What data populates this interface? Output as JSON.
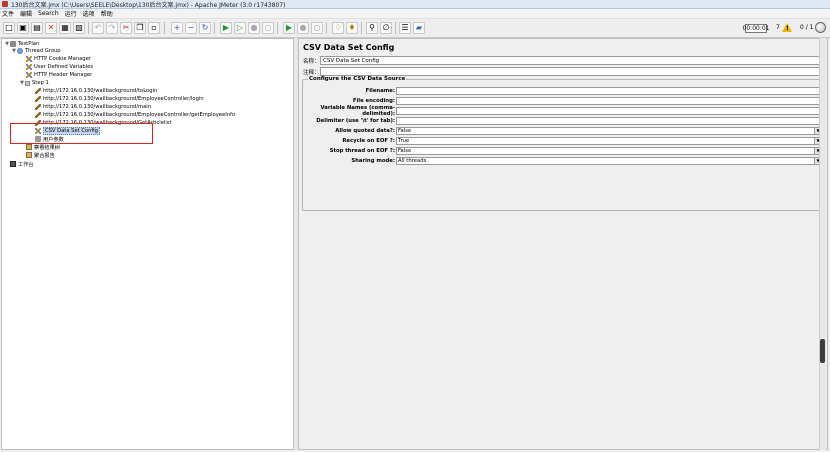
{
  "window": {
    "title": "130后台文案.jmx (C:\\Users\\SEELE\\Desktop\\130后台文案.jmx) - Apache JMeter (3.0 r1743807)"
  },
  "menu": [
    "文件",
    "编辑",
    "Search",
    "运行",
    "选项",
    "帮助"
  ],
  "toolbar": {
    "buttons": [
      "new-icon",
      "templates-icon",
      "open-icon",
      "close-icon",
      "save-icon",
      "save-as-icon",
      "undo-icon",
      "redo-icon",
      "cut-icon",
      "copy-icon",
      "paste-icon",
      "expand-icon",
      "collapse-icon",
      "toggle-icon",
      "start-icon",
      "start-no-pause-icon",
      "stop-icon",
      "shutdown-icon",
      "remote-start-icon",
      "remote-stop-icon",
      "remote-shutdown-icon",
      "clear-icon",
      "clear-all-icon",
      "search-icon",
      "reset-search-icon",
      "function-helper-icon",
      "help-icon"
    ],
    "elapsed_time": "00:00:01",
    "warning_count": "7",
    "active_threads": "0 / 1"
  },
  "tree": {
    "nodes": [
      {
        "label": "TestPlan",
        "icon": "testplan-icon",
        "indent": 0,
        "twisty": "▼"
      },
      {
        "label": "Thread Group",
        "icon": "thread-group-icon",
        "indent": 1,
        "twisty": "▼"
      },
      {
        "label": "HTTP Cookie Manager",
        "icon": "config-wrench-icon",
        "indent": 2,
        "twisty": ""
      },
      {
        "label": "User Defined Variables",
        "icon": "config-wrench-icon",
        "indent": 2,
        "twisty": ""
      },
      {
        "label": "HTTP Header Manager",
        "icon": "config-wrench-icon",
        "indent": 2,
        "twisty": ""
      },
      {
        "label": "Step 1",
        "icon": "transaction-controller-icon",
        "indent": 2,
        "twisty": "▼"
      },
      {
        "label": "http://172.16.0.130/wallbackground/toLogin",
        "icon": "sampler-pencil-icon",
        "indent": 3,
        "twisty": ""
      },
      {
        "label": "http://172.16.0.130/wallbackground/EmployeeController/login",
        "icon": "sampler-pencil-icon",
        "indent": 3,
        "twisty": ""
      },
      {
        "label": "http://172.16.0.130/wallbackground/main",
        "icon": "sampler-pencil-icon",
        "indent": 3,
        "twisty": ""
      },
      {
        "label": "http://172.16.0.130/wallbackground/EmployeeController/getEmployeeInfo",
        "icon": "sampler-pencil-icon",
        "indent": 3,
        "twisty": ""
      },
      {
        "label": "http://172.16.0.130/wallbackground/GetArticlelist",
        "icon": "sampler-pencil-icon",
        "indent": 3,
        "twisty": ""
      },
      {
        "label": "CSV Data Set Config",
        "icon": "config-wrench-icon",
        "indent": 3,
        "twisty": "",
        "selected": true
      },
      {
        "label": "用户参数",
        "icon": "user-parameters-icon",
        "indent": 3,
        "twisty": ""
      },
      {
        "label": "察看结果树",
        "icon": "listener-icon",
        "indent": 2,
        "twisty": ""
      },
      {
        "label": "聚合报告",
        "icon": "listener-icon",
        "indent": 2,
        "twisty": ""
      },
      {
        "label": "工作台",
        "icon": "workbench-icon",
        "indent": 0,
        "twisty": ""
      }
    ]
  },
  "config": {
    "heading": "CSV Data Set Config",
    "name_label": "名称：",
    "name_value": "CSV Data Set Config",
    "comment_label": "注释：",
    "comment_value": "",
    "section_title": "Configure the CSV Data Source",
    "fields": [
      {
        "label": "Filename:",
        "value": "",
        "type": "text"
      },
      {
        "label": "File encoding:",
        "value": "",
        "type": "text"
      },
      {
        "label": "Variable Names (comma-delimited):",
        "value": "",
        "type": "text"
      },
      {
        "label": "Delimiter (use '\\t' for tab):",
        "value": "",
        "type": "text"
      },
      {
        "label": "Allow quoted data?:",
        "value": "False",
        "type": "select"
      },
      {
        "label": "Recycle on EOF ?:",
        "value": "True",
        "type": "select"
      },
      {
        "label": "Stop thread on EOF ?:",
        "value": "False",
        "type": "select"
      },
      {
        "label": "Sharing mode:",
        "value": "All threads",
        "type": "select"
      }
    ]
  }
}
